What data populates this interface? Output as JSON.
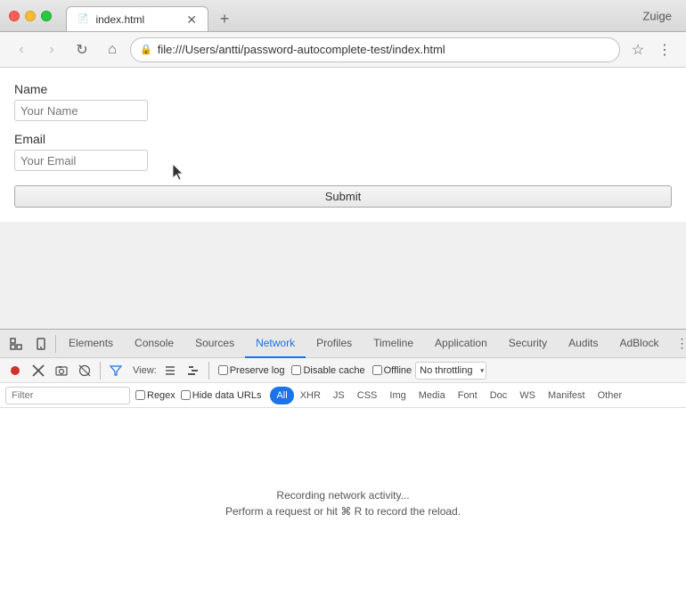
{
  "browser": {
    "window_title": "Zuige",
    "tab_title": "index.html",
    "tab_favicon": "📄",
    "address": "file:///Users/antti/password-autocomplete-test/index.html",
    "new_tab_label": "+"
  },
  "nav": {
    "back_label": "‹",
    "forward_label": "›",
    "refresh_label": "↻",
    "home_label": "⌂",
    "bookmark_label": "☆",
    "more_label": "⋮"
  },
  "form": {
    "name_label": "Name",
    "name_placeholder": "Your Name",
    "email_label": "Email",
    "email_placeholder": "Your Email",
    "submit_label": "Submit"
  },
  "devtools": {
    "tabs": [
      {
        "id": "elements",
        "label": "Elements"
      },
      {
        "id": "console",
        "label": "Console"
      },
      {
        "id": "sources",
        "label": "Sources"
      },
      {
        "id": "network",
        "label": "Network",
        "active": true
      },
      {
        "id": "profiles",
        "label": "Profiles"
      },
      {
        "id": "timeline",
        "label": "Timeline"
      },
      {
        "id": "application",
        "label": "Application"
      },
      {
        "id": "security",
        "label": "Security"
      },
      {
        "id": "audits",
        "label": "Audits"
      },
      {
        "id": "adblock",
        "label": "AdBlock"
      }
    ],
    "toolbar": {
      "view_label": "View:",
      "preserve_log_label": "Preserve log",
      "disable_cache_label": "Disable cache",
      "offline_label": "Offline",
      "throttle_value": "No throttling"
    },
    "filterbar": {
      "placeholder": "Filter",
      "regex_label": "Regex",
      "hide_urls_label": "Hide data URLs",
      "type_filters": [
        "All",
        "XHR",
        "JS",
        "CSS",
        "Img",
        "Media",
        "Font",
        "Doc",
        "WS",
        "Manifest",
        "Other"
      ]
    },
    "empty_message": "Recording network activity...",
    "empty_hint": "Perform a request or hit",
    "empty_hint2": "R to record the reload.",
    "cmd_symbol": "⌘"
  }
}
